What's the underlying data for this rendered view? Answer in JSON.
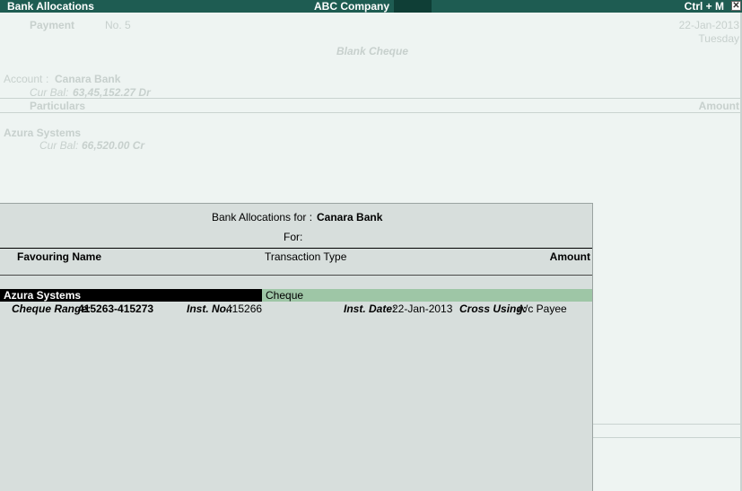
{
  "titlebar": {
    "title": "Bank Allocations",
    "company": "ABC Company",
    "shortcut": "Ctrl + M",
    "close_glyph": "✕"
  },
  "voucher": {
    "type": "Payment",
    "number": "No. 5",
    "date": "22-Jan-2013",
    "day": "Tuesday",
    "mode": "Blank Cheque",
    "account_label": "Account",
    "account_name": "Canara Bank",
    "cur_bal_label": "Cur Bal:",
    "account_cur_bal": "63,45,152.27 Dr",
    "col_particulars": "Particulars",
    "col_amount": "Amount",
    "ledger_name": "Azura Systems",
    "ledger_cur_bal": "66,520.00 Cr"
  },
  "popup": {
    "heading_label": "Bank Allocations for :",
    "heading_bank": "Canara Bank",
    "for_label": "For:",
    "col_favouring": "Favouring Name",
    "col_type": "Transaction Type",
    "col_amount": "Amount",
    "row": {
      "favouring_name": "Azura Systems",
      "transaction_type": "Cheque",
      "cheque_range_label": "Cheque Range:",
      "cheque_range": "415263-415273",
      "inst_no_label": "Inst. No.:",
      "inst_no": "415266",
      "inst_date_label": "Inst. Date:",
      "inst_date": "22-Jan-2013",
      "cross_using_label": "Cross Using:",
      "cross_using": "A/c Payee"
    }
  }
}
